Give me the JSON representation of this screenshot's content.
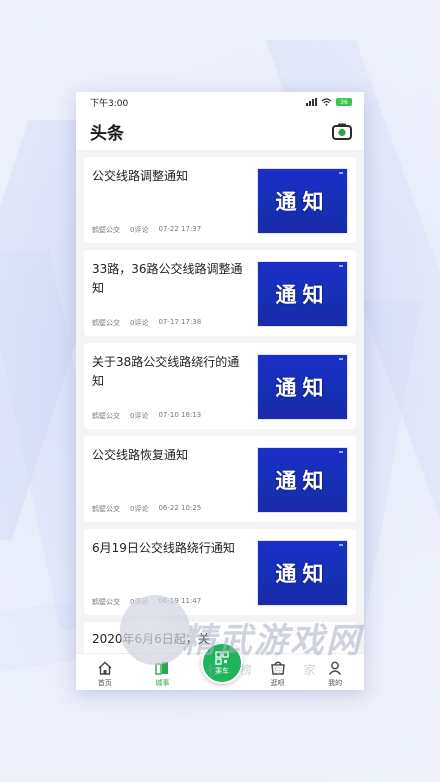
{
  "status_bar": {
    "time": "下午3:00",
    "battery": "36"
  },
  "header": {
    "title": "头条"
  },
  "articles": [
    {
      "title": "公交线路调整通知",
      "source": "鹤壁公交",
      "comments": "0评论",
      "date": "07-22 17:37",
      "thumb_text": "通知"
    },
    {
      "title": "33路，36路公交线路调整通知",
      "source": "鹤壁公交",
      "comments": "0评论",
      "date": "07-17 17:38",
      "thumb_text": "通知"
    },
    {
      "title": "关于38路公交线路绕行的通知",
      "source": "鹤壁公交",
      "comments": "0评论",
      "date": "07-10 18:13",
      "thumb_text": "通知"
    },
    {
      "title": "公交线路恢复通知",
      "source": "鹤壁公交",
      "comments": "0评论",
      "date": "06-22 10:25",
      "thumb_text": "通知"
    },
    {
      "title": "6月19日公交线路绕行通知",
      "source": "鹤壁公交",
      "comments": "0评论",
      "date": "06-19 11:47",
      "thumb_text": "通知"
    }
  ],
  "partial_article": {
    "title": "2020年6月6日起，关"
  },
  "tabbar": {
    "home": "首页",
    "city": "城事",
    "ride": "乘车",
    "stroll": "逛呗",
    "mine": "我的"
  },
  "watermark": {
    "text": "精武游戏网",
    "sub": "行 榜 专 家"
  },
  "colors": {
    "accent_green": "#1fb45a",
    "notice_blue": "#1b2fc8",
    "active_tab": "#2aa84a"
  }
}
